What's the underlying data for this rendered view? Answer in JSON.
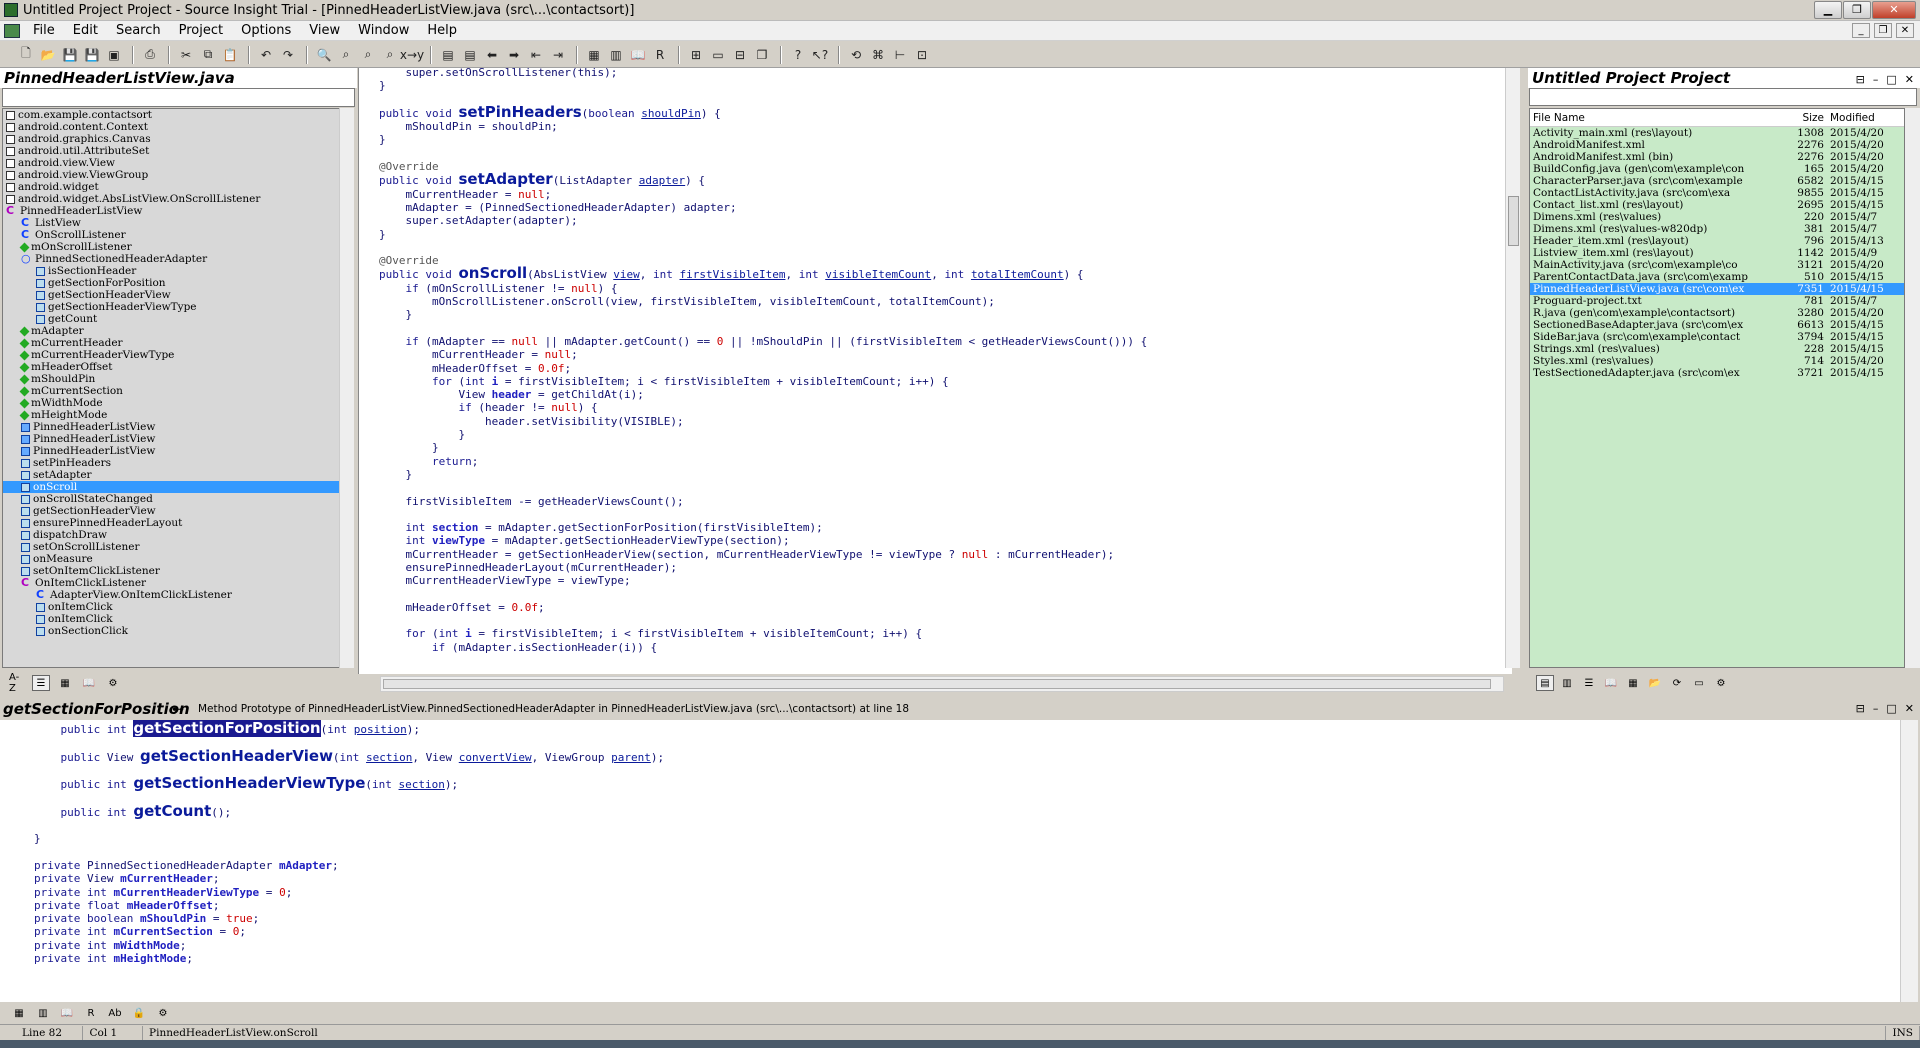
{
  "window": {
    "title": "Untitled Project Project - Source Insight Trial - [PinnedHeaderListView.java (src\\...\\contactsort)]"
  },
  "menu": [
    "File",
    "Edit",
    "Search",
    "Project",
    "Options",
    "View",
    "Window",
    "Help"
  ],
  "symbol_panel": {
    "title": "PinnedHeaderListView.java",
    "items": [
      {
        "label": "com.example.contactsort",
        "indent": 0,
        "icon": "import-icon"
      },
      {
        "label": "android.content.Context",
        "indent": 0,
        "icon": "import-icon"
      },
      {
        "label": "android.graphics.Canvas",
        "indent": 0,
        "icon": "import-icon"
      },
      {
        "label": "android.util.AttributeSet",
        "indent": 0,
        "icon": "import-icon"
      },
      {
        "label": "android.view.View",
        "indent": 0,
        "icon": "import-icon"
      },
      {
        "label": "android.view.ViewGroup",
        "indent": 0,
        "icon": "import-icon"
      },
      {
        "label": "android.widget",
        "indent": 0,
        "icon": "import-icon"
      },
      {
        "label": "android.widget.AbsListView.OnScrollListener",
        "indent": 0,
        "icon": "import-icon"
      },
      {
        "label": "PinnedHeaderListView",
        "indent": 0,
        "icon": "class-icon"
      },
      {
        "label": "ListView",
        "indent": 1,
        "icon": "superclass-icon"
      },
      {
        "label": "OnScrollListener",
        "indent": 1,
        "icon": "superclass-icon"
      },
      {
        "label": "mOnScrollListener",
        "indent": 1,
        "icon": "field-icon"
      },
      {
        "label": "PinnedSectionedHeaderAdapter",
        "indent": 1,
        "icon": "interface-icon"
      },
      {
        "label": "isSectionHeader",
        "indent": 2,
        "icon": "method-icon"
      },
      {
        "label": "getSectionForPosition",
        "indent": 2,
        "icon": "method-icon"
      },
      {
        "label": "getSectionHeaderView",
        "indent": 2,
        "icon": "method-icon"
      },
      {
        "label": "getSectionHeaderViewType",
        "indent": 2,
        "icon": "method-icon"
      },
      {
        "label": "getCount",
        "indent": 2,
        "icon": "method-icon"
      },
      {
        "label": "mAdapter",
        "indent": 1,
        "icon": "field-icon"
      },
      {
        "label": "mCurrentHeader",
        "indent": 1,
        "icon": "field-icon"
      },
      {
        "label": "mCurrentHeaderViewType",
        "indent": 1,
        "icon": "field-icon"
      },
      {
        "label": "mHeaderOffset",
        "indent": 1,
        "icon": "field-icon"
      },
      {
        "label": "mShouldPin",
        "indent": 1,
        "icon": "field-icon"
      },
      {
        "label": "mCurrentSection",
        "indent": 1,
        "icon": "field-icon"
      },
      {
        "label": "mWidthMode",
        "indent": 1,
        "icon": "field-icon"
      },
      {
        "label": "mHeightMode",
        "indent": 1,
        "icon": "field-icon"
      },
      {
        "label": "PinnedHeaderListView",
        "indent": 1,
        "icon": "constructor-icon"
      },
      {
        "label": "PinnedHeaderListView",
        "indent": 1,
        "icon": "constructor-icon"
      },
      {
        "label": "PinnedHeaderListView",
        "indent": 1,
        "icon": "constructor-icon"
      },
      {
        "label": "setPinHeaders",
        "indent": 1,
        "icon": "method-icon"
      },
      {
        "label": "setAdapter",
        "indent": 1,
        "icon": "method-icon"
      },
      {
        "label": "onScroll",
        "indent": 1,
        "icon": "method-icon",
        "selected": true
      },
      {
        "label": "onScrollStateChanged",
        "indent": 1,
        "icon": "method-icon"
      },
      {
        "label": "getSectionHeaderView",
        "indent": 1,
        "icon": "method-icon"
      },
      {
        "label": "ensurePinnedHeaderLayout",
        "indent": 1,
        "icon": "method-icon"
      },
      {
        "label": "dispatchDraw",
        "indent": 1,
        "icon": "method-icon"
      },
      {
        "label": "setOnScrollListener",
        "indent": 1,
        "icon": "method-icon"
      },
      {
        "label": "onMeasure",
        "indent": 1,
        "icon": "method-icon"
      },
      {
        "label": "setOnItemClickListener",
        "indent": 1,
        "icon": "method-icon"
      },
      {
        "label": "OnItemClickListener",
        "indent": 1,
        "icon": "class-icon"
      },
      {
        "label": "AdapterView.OnItemClickListener",
        "indent": 2,
        "icon": "superclass-icon"
      },
      {
        "label": "onItemClick",
        "indent": 2,
        "icon": "method-icon"
      },
      {
        "label": "onItemClick",
        "indent": 2,
        "icon": "method-icon"
      },
      {
        "label": "onSectionClick",
        "indent": 2,
        "icon": "method-icon"
      }
    ]
  },
  "project_panel": {
    "title": "Untitled Project Project",
    "columns": [
      "File Name",
      "Size",
      "Modified"
    ],
    "files": [
      [
        "Activity_main.xml (res\\layout)",
        "1308",
        "2015/4/20"
      ],
      [
        "AndroidManifest.xml",
        "2276",
        "2015/4/20"
      ],
      [
        "AndroidManifest.xml (bin)",
        "2276",
        "2015/4/20"
      ],
      [
        "BuildConfig.java (gen\\com\\example\\con",
        "165",
        "2015/4/20"
      ],
      [
        "CharacterParser.java (src\\com\\example",
        "6582",
        "2015/4/15"
      ],
      [
        "ContactListActivity.java (src\\com\\exa",
        "9855",
        "2015/4/15"
      ],
      [
        "Contact_list.xml (res\\layout)",
        "2695",
        "2015/4/15"
      ],
      [
        "Dimens.xml (res\\values)",
        "220",
        "2015/4/7"
      ],
      [
        "Dimens.xml (res\\values-w820dp)",
        "381",
        "2015/4/7"
      ],
      [
        "Header_item.xml (res\\layout)",
        "796",
        "2015/4/13"
      ],
      [
        "Listview_item.xml (res\\layout)",
        "1142",
        "2015/4/9"
      ],
      [
        "MainActivity.java (src\\com\\example\\co",
        "3121",
        "2015/4/20"
      ],
      [
        "ParentContactData.java (src\\com\\examp",
        "510",
        "2015/4/15"
      ],
      [
        "PinnedHeaderListView.java (src\\com\\ex",
        "7351",
        "2015/4/15"
      ],
      [
        "Proguard-project.txt",
        "781",
        "2015/4/7"
      ],
      [
        "R.java (gen\\com\\example\\contactsort)",
        "3280",
        "2015/4/20"
      ],
      [
        "SectionedBaseAdapter.java (src\\com\\ex",
        "6613",
        "2015/4/15"
      ],
      [
        "SideBar.java (src\\com\\example\\contact",
        "3794",
        "2015/4/15"
      ],
      [
        "Strings.xml (res\\values)",
        "228",
        "2015/4/15"
      ],
      [
        "Styles.xml (res\\values)",
        "714",
        "2015/4/20"
      ],
      [
        "TestSectionedAdapter.java (src\\com\\ex",
        "3721",
        "2015/4/15"
      ]
    ],
    "selected_index": 13
  },
  "context": {
    "symbol": "getSectionForPosition",
    "description": "Method Prototype of PinnedHeaderListView.PinnedSectionedHeaderAdapter in PinnedHeaderListView.java (src\\...\\contactsort) at line 18"
  },
  "status": {
    "line": "Line 82",
    "col": "Col 1",
    "symbol": "PinnedHeaderListView.onScroll",
    "mode": "INS"
  },
  "footer_sort_label": "A-Z"
}
